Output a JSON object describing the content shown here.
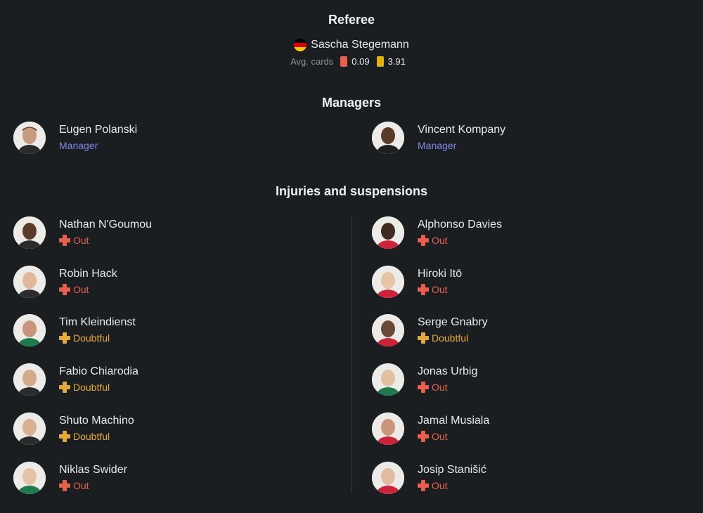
{
  "referee": {
    "title": "Referee",
    "name": "Sascha Stegemann",
    "flag_icon": "germany-flag-icon",
    "avg_label": "Avg. cards",
    "red_avg": "0.09",
    "yellow_avg": "3.91",
    "red_color": "#e8604c",
    "yellow_color": "#e0b400"
  },
  "managers": {
    "title": "Managers",
    "left": {
      "name": "Eugen Polanski",
      "role": "Manager"
    },
    "right": {
      "name": "Vincent Kompany",
      "role": "Manager"
    }
  },
  "injuries": {
    "title": "Injuries and suspensions",
    "left": [
      {
        "name": "Nathan N'Goumou",
        "status": "Out"
      },
      {
        "name": "Robin Hack",
        "status": "Out"
      },
      {
        "name": "Tim Kleindienst",
        "status": "Doubtful"
      },
      {
        "name": "Fabio Chiarodia",
        "status": "Doubtful"
      },
      {
        "name": "Shuto Machino",
        "status": "Doubtful"
      },
      {
        "name": "Niklas Swider",
        "status": "Out"
      }
    ],
    "right": [
      {
        "name": "Alphonso Davies",
        "status": "Out"
      },
      {
        "name": "Hiroki Itō",
        "status": "Out"
      },
      {
        "name": "Serge Gnabry",
        "status": "Doubtful"
      },
      {
        "name": "Jonas Urbig",
        "status": "Out"
      },
      {
        "name": "Jamal Musiala",
        "status": "Out"
      },
      {
        "name": "Josip Stanišić",
        "status": "Out"
      }
    ]
  },
  "colors": {
    "background": "#1b1e21",
    "manager_role": "#7f86e6",
    "out": "#e8604c",
    "doubtful": "#e3a93a"
  }
}
